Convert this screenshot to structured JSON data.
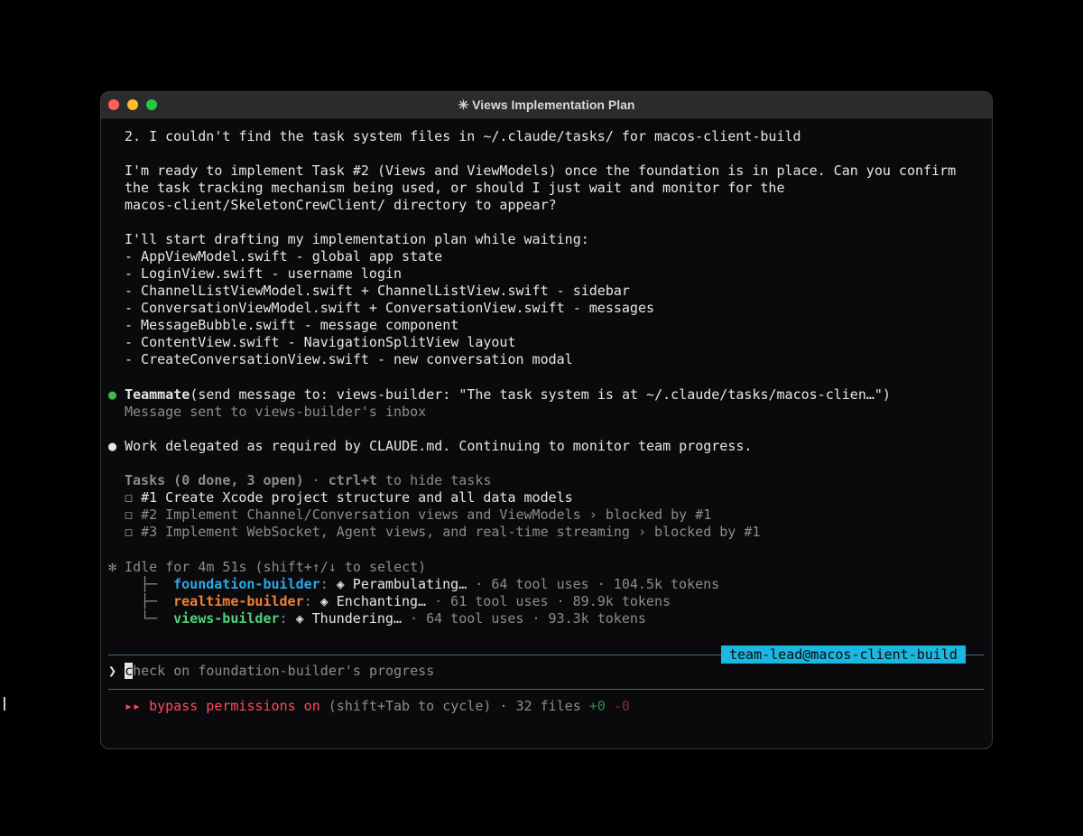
{
  "window": {
    "title": "✳ Views Implementation Plan"
  },
  "messages": {
    "line1": "2. I couldn't find the task system files in ~/.claude/tasks/ for macos-client-build",
    "para1": [
      "I'm ready to implement Task #2 (Views and ViewModels) once the foundation is in place. Can you confirm",
      "the task tracking mechanism being used, or should I just wait and monitor for the",
      "macos-client/SkeletonCrewClient/ directory to appear?"
    ],
    "plan_intro": "I'll start drafting my implementation plan while waiting:",
    "plan_items": [
      "- AppViewModel.swift - global app state",
      "- LoginView.swift - username login",
      "- ChannelListViewModel.swift + ChannelListView.swift - sidebar",
      "- ConversationViewModel.swift + ConversationView.swift - messages",
      "- MessageBubble.swift - message component",
      "- ContentView.swift - NavigationSplitView layout",
      "- CreateConversationView.swift - new conversation modal"
    ]
  },
  "teammate_call": {
    "bullet": "●",
    "name": "Teammate",
    "args": "(send message to: views-builder: \"The task system is at ~/.claude/tasks/macos-clien…\")",
    "result": "Message sent to views-builder's inbox"
  },
  "delegation": {
    "bullet": "●",
    "text": "Work delegated as required by CLAUDE.md. Continuing to monitor team progress."
  },
  "tasks": {
    "header_bold": "Tasks (0 done, 3 open)",
    "sep": " · ",
    "shortcut": "ctrl+t",
    "shortcut_suffix": " to hide tasks",
    "checkbox": "◻",
    "items": [
      {
        "id": "#1",
        "text": "Create Xcode project structure and all data models",
        "blocked": ""
      },
      {
        "id": "#2",
        "text": "Implement Channel/Conversation views and ViewModels",
        "blocked": " › blocked by #1"
      },
      {
        "id": "#3",
        "text": "Implement WebSocket, Agent views, and real-time streaming",
        "blocked": " › blocked by #1"
      }
    ]
  },
  "idle": {
    "text": "✻ Idle for 4m 51s (shift+↑/↓ to select)",
    "agents": [
      {
        "branch": "├─",
        "name": "foundation-builder",
        "activity": "◈ Perambulating…",
        "stats": " · 64 tool uses · 104.5k tokens",
        "color": "#2aa9e8"
      },
      {
        "branch": "├─",
        "name": "realtime-builder",
        "activity": "◈ Enchanting…",
        "stats": " · 61 tool uses · 89.9k tokens",
        "color": "#f08036"
      },
      {
        "branch": "└─",
        "name": "views-builder",
        "activity": "◈ Thundering…",
        "stats": " · 64 tool uses · 93.3k tokens",
        "color": "#4fd07a"
      }
    ]
  },
  "prompt": {
    "badge": "team-lead@macos-client-build",
    "caret": "❯",
    "cursor_char": "c",
    "input_rest": "heck on foundation-builder's progress"
  },
  "status": {
    "arrows": "▸▸",
    "label": "bypass permissions on",
    "hint": " (shift+Tab to cycle) · 32 files ",
    "added": "+0",
    "removed": "-0"
  },
  "colors": {
    "accent": "#1ab8e0",
    "red": "#ff4a5a",
    "green": "#3fb950"
  },
  "icons": {
    "ibeam": "I"
  }
}
